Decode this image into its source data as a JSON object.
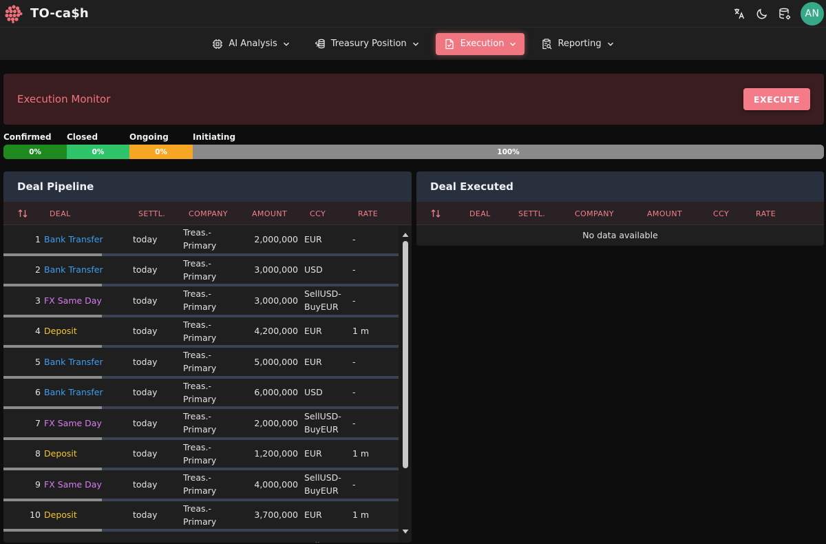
{
  "app": {
    "title": "TO-ca$h",
    "logo": "berry-logo-icon"
  },
  "topbar": {
    "icons": [
      "translate-icon",
      "dark-mode-icon",
      "database-settings-icon"
    ],
    "avatar_initials": "AN",
    "avatar_color": "#37a989"
  },
  "nav": [
    {
      "label": "AI Analysis",
      "icon": "cpu-icon",
      "active": false
    },
    {
      "label": "Treasury Position",
      "icon": "coins-icon",
      "active": true
    },
    {
      "label": "Execution",
      "icon": "document-check-icon",
      "active": true
    },
    {
      "label": "Reporting",
      "icon": "clipboard-search-icon",
      "active": false
    }
  ],
  "monitor": {
    "title": "Execution Monitor",
    "execute_label": "EXECUTE"
  },
  "status": {
    "labels": [
      "Confirmed",
      "Closed",
      "Ongoing",
      "Initiating"
    ],
    "segments": [
      {
        "label": "Confirmed",
        "value": "0%",
        "color": "#1e8a1e"
      },
      {
        "label": "Closed",
        "value": "0%",
        "color": "#2fc46a"
      },
      {
        "label": "Ongoing",
        "value": "0%",
        "color": "#f5a623"
      },
      {
        "label": "Initiating",
        "value": "100%",
        "color": "#8a8a8a"
      }
    ]
  },
  "pipeline": {
    "title": "Deal Pipeline",
    "columns": [
      "DEAL",
      "SETTL.",
      "COMPANY",
      "AMOUNT",
      "CCY",
      "RATE"
    ],
    "rows": [
      {
        "n": "1",
        "deal": "Bank Transfer",
        "type": "bank",
        "settl": "today",
        "company": "Treas.- Primary",
        "amount": "2,000,000",
        "ccy": "EUR",
        "rate": "-"
      },
      {
        "n": "2",
        "deal": "Bank Transfer",
        "type": "bank",
        "settl": "today",
        "company": "Treas.- Primary",
        "amount": "3,000,000",
        "ccy": "USD",
        "rate": "-"
      },
      {
        "n": "3",
        "deal": "FX Same Day",
        "type": "fx",
        "settl": "today",
        "company": "Treas.- Primary",
        "amount": "3,000,000",
        "ccy": "SellUSD- BuyEUR",
        "rate": "-"
      },
      {
        "n": "4",
        "deal": "Deposit",
        "type": "deposit",
        "settl": "today",
        "company": "Treas.- Primary",
        "amount": "4,200,000",
        "ccy": "EUR",
        "rate": "1 m"
      },
      {
        "n": "5",
        "deal": "Bank Transfer",
        "type": "bank",
        "settl": "today",
        "company": "Treas.- Primary",
        "amount": "5,000,000",
        "ccy": "EUR",
        "rate": "-"
      },
      {
        "n": "6",
        "deal": "Bank Transfer",
        "type": "bank",
        "settl": "today",
        "company": "Treas.- Primary",
        "amount": "6,000,000",
        "ccy": "USD",
        "rate": "-"
      },
      {
        "n": "7",
        "deal": "FX Same Day",
        "type": "fx",
        "settl": "today",
        "company": "Treas.- Primary",
        "amount": "2,000,000",
        "ccy": "SellUSD- BuyEUR",
        "rate": "-"
      },
      {
        "n": "8",
        "deal": "Deposit",
        "type": "deposit",
        "settl": "today",
        "company": "Treas.- Primary",
        "amount": "1,200,000",
        "ccy": "EUR",
        "rate": "1 m"
      },
      {
        "n": "9",
        "deal": "FX Same Day",
        "type": "fx",
        "settl": "today",
        "company": "Treas.- Primary",
        "amount": "4,000,000",
        "ccy": "SellUSD- BuyEUR",
        "rate": "-"
      },
      {
        "n": "10",
        "deal": "Deposit",
        "type": "deposit",
        "settl": "today",
        "company": "Treas.- Primary",
        "amount": "3,700,000",
        "ccy": "EUR",
        "rate": "1 m"
      },
      {
        "n": "",
        "deal": "",
        "type": "",
        "settl": "",
        "company": "Treas.-",
        "amount": "",
        "ccy": "SellGBP-",
        "rate": ""
      }
    ]
  },
  "executed": {
    "title": "Deal Executed",
    "columns": [
      "DEAL",
      "SETTL.",
      "COMPANY",
      "AMOUNT",
      "CCY",
      "RATE"
    ],
    "empty_text": "No data available"
  }
}
